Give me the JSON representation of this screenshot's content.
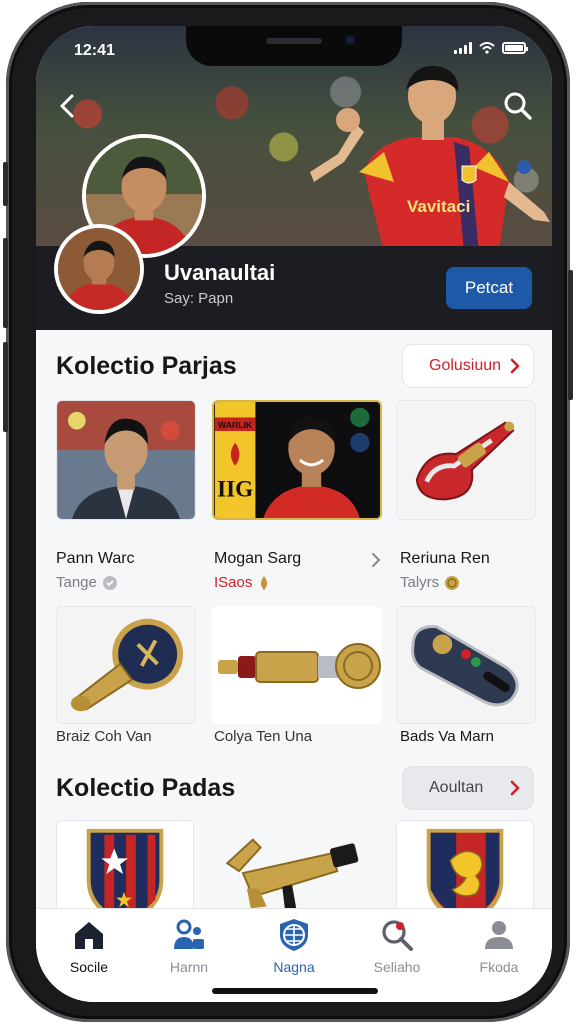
{
  "status": {
    "time": "12:41"
  },
  "profile": {
    "name": "Uvanaultai",
    "subtitle": "Say: Papn",
    "follow_label": "Petcat"
  },
  "sections": [
    {
      "title": "Kolectio Parjas",
      "action_label": "Golusiuun",
      "items": [
        {
          "name": "Pann Warc",
          "sub": "Tange"
        },
        {
          "name": "Mogan Sarg",
          "sub": "ISaos"
        },
        {
          "name": "Reriuna Ren",
          "sub": "Talyrs"
        },
        {
          "name": "Braiz Coh Van"
        },
        {
          "name": "Colya Ten Una"
        },
        {
          "name": "Bads Va Marn"
        }
      ]
    },
    {
      "title": "Kolectio Padas",
      "action_label": "Aoultan"
    }
  ],
  "card_badge": {
    "top": "WARLIK",
    "letters": "IIG"
  },
  "jersey_text": "Vavitaci",
  "tabs": [
    {
      "label": "Socile",
      "icon": "home-icon"
    },
    {
      "label": "Harnn",
      "icon": "people-icon"
    },
    {
      "label": "Nagna",
      "icon": "globe-shield-icon"
    },
    {
      "label": "Seliaho",
      "icon": "search-icon"
    },
    {
      "label": "Fkoda",
      "icon": "person-icon"
    }
  ],
  "colors": {
    "accent_red": "#d0202a",
    "accent_blue": "#1e5aa8",
    "tab_active_blue": "#2a63b0"
  }
}
